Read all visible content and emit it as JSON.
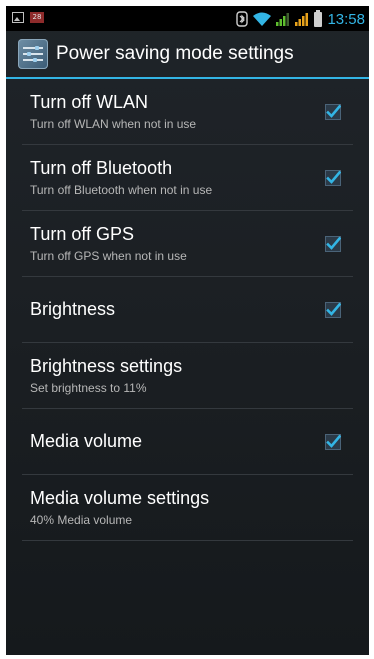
{
  "status_bar": {
    "time": "13:58",
    "calendar_badge": "28",
    "icons": [
      "picture-icon",
      "calendar-icon",
      "bluetooth-icon",
      "wifi-icon",
      "signal-icon",
      "signal-icon",
      "battery-icon"
    ]
  },
  "action_bar": {
    "title": "Power saving mode settings",
    "icon": "settings-sliders-icon"
  },
  "settings": [
    {
      "label": "Turn off WLAN",
      "summary": "Turn off WLAN when not in use",
      "checked": true
    },
    {
      "label": "Turn off Bluetooth",
      "summary": "Turn off Bluetooth when not in use",
      "checked": true
    },
    {
      "label": "Turn off GPS",
      "summary": "Turn off GPS when not in use",
      "checked": true
    },
    {
      "label": "Brightness",
      "checked": true
    },
    {
      "label": "Brightness settings",
      "summary": "Set brightness to 11%"
    },
    {
      "label": "Media volume",
      "checked": true
    },
    {
      "label": "Media volume settings",
      "summary": "40% Media volume"
    }
  ],
  "colors": {
    "accent": "#33b5e5",
    "background": "#1b1f23",
    "divider": "#34393e"
  }
}
